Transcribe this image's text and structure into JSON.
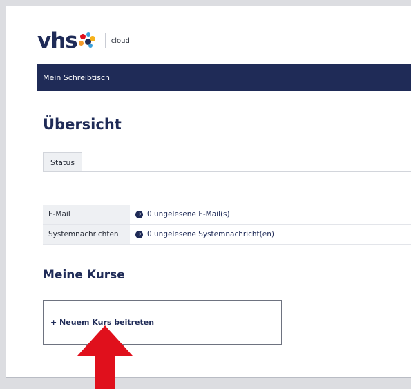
{
  "logo": {
    "brand": "vhs",
    "product": "cloud"
  },
  "nav": {
    "item": "Mein Schreibtisch"
  },
  "page": {
    "title": "Übersicht"
  },
  "tabs": [
    {
      "label": "Status"
    }
  ],
  "status_rows": [
    {
      "label": "E-Mail",
      "value": "0 ungelesene E-Mail(s)"
    },
    {
      "label": "Systemnachrichten",
      "value": "0 ungelesene Systemnachricht(en)"
    }
  ],
  "courses": {
    "heading": "Meine Kurse",
    "join_label": "+ Neuem Kurs beitreten"
  },
  "colors": {
    "brand": "#1f2b57",
    "highlight_arrow": "#e0101c"
  },
  "icons": {
    "row_icon": "arrow-circle-right-icon",
    "annotation": "red-up-arrow-icon"
  }
}
